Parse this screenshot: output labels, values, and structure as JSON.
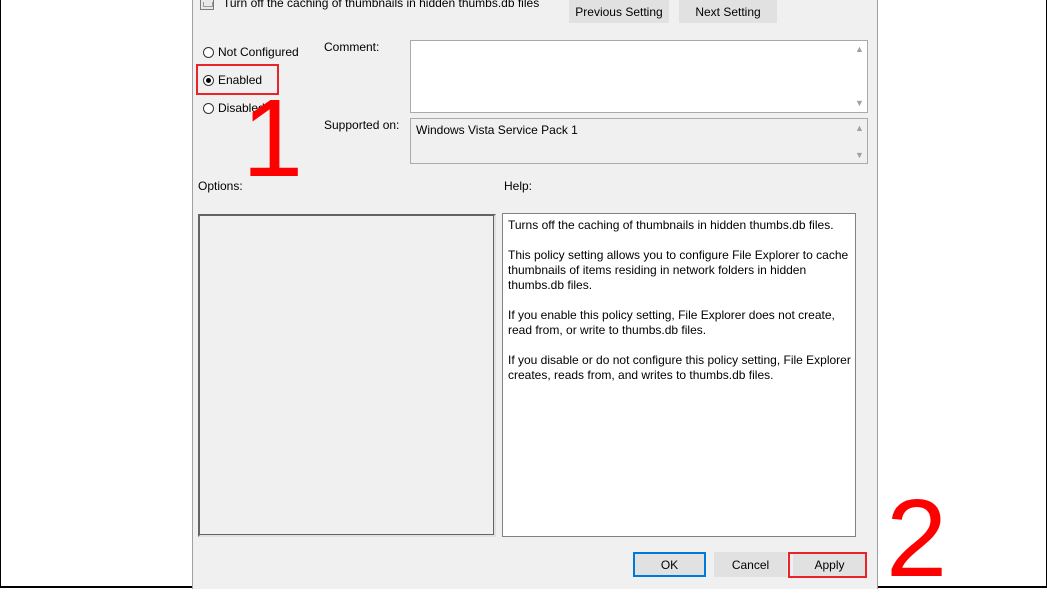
{
  "window": {
    "title": "Turn off the caching of thumbnails in hidden thumbs.db files"
  },
  "nav": {
    "previous_label": "Previous Setting",
    "next_label": "Next Setting"
  },
  "state": {
    "options": [
      {
        "label": "Not Configured",
        "checked": false
      },
      {
        "label": "Enabled",
        "checked": true
      },
      {
        "label": "Disabled",
        "checked": false
      }
    ]
  },
  "comment": {
    "label": "Comment:",
    "value": ""
  },
  "supported": {
    "label": "Supported on:",
    "value": "Windows Vista Service Pack 1"
  },
  "options_section": {
    "label": "Options:"
  },
  "help_section": {
    "label": "Help:",
    "paragraphs": [
      "Turns off the caching of thumbnails in hidden thumbs.db files.",
      "This policy setting allows you to configure File Explorer to cache thumbnails of items residing in network folders in hidden thumbs.db files.",
      "If you enable this policy setting, File Explorer does not create, read from, or write to thumbs.db files.",
      "If you disable or do not configure this policy setting, File Explorer creates, reads from, and writes to thumbs.db files."
    ]
  },
  "buttons": {
    "ok_label": "OK",
    "cancel_label": "Cancel",
    "apply_label": "Apply"
  },
  "annotations": {
    "step1": "1",
    "step2": "2",
    "highlight_color": "#e8232a"
  }
}
